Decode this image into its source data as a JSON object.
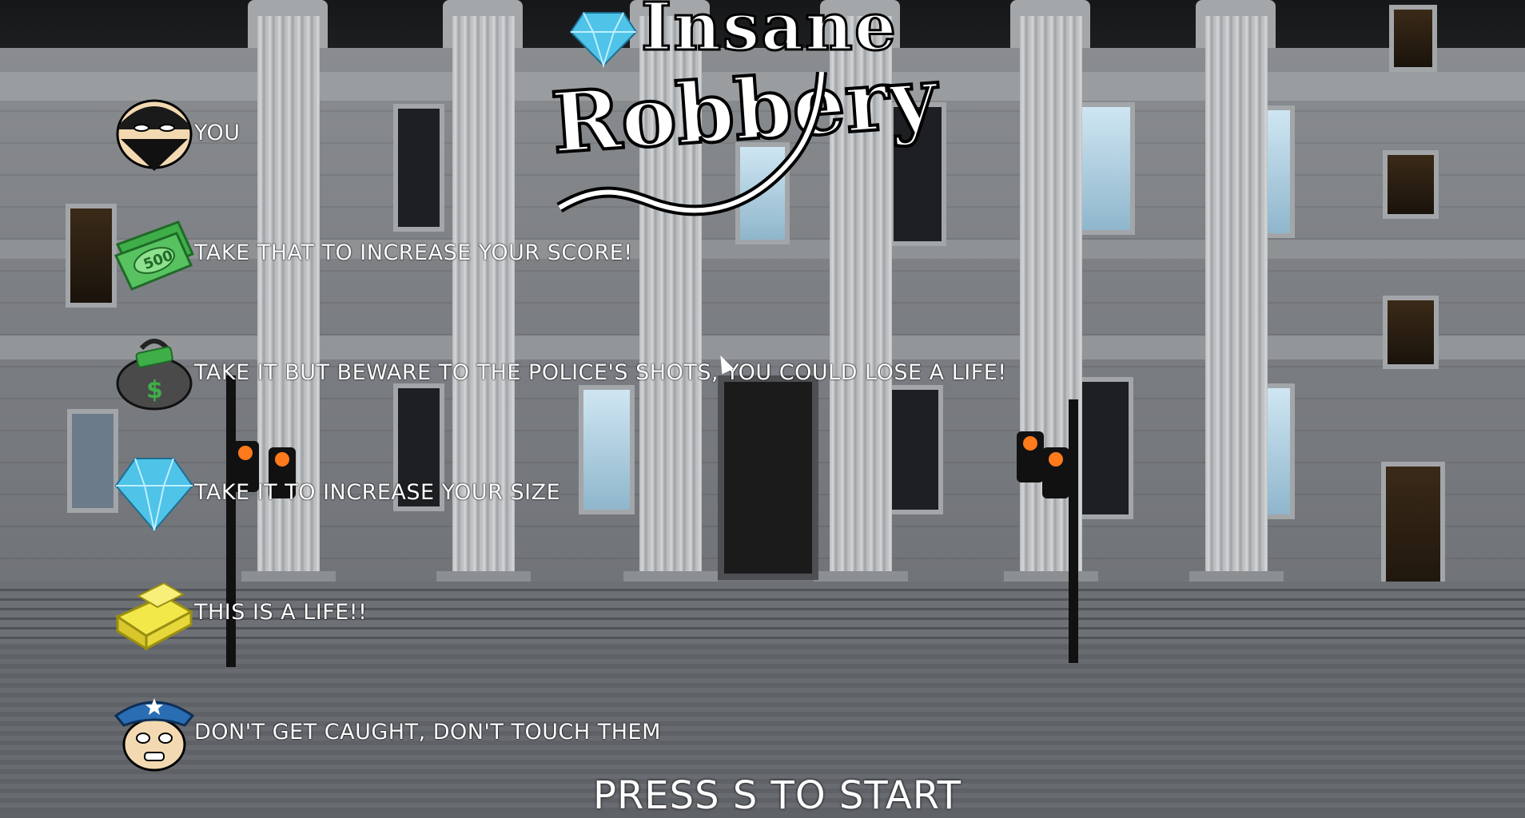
{
  "title": {
    "line1": "Insane",
    "line2": "Robbery"
  },
  "legend": [
    {
      "icon": "robber-icon",
      "text": "YOU"
    },
    {
      "icon": "money-500-icon",
      "text": "TAKE THAT TO INCREASE YOUR SCORE!"
    },
    {
      "icon": "money-bag-icon",
      "text": "TAKE IT BUT BEWARE TO THE POLICE'S SHOTS, YOU COULD LOSE A LIFE!"
    },
    {
      "icon": "diamond-icon",
      "text": "TAKE IT TO INCREASE YOUR SIZE"
    },
    {
      "icon": "gold-bar-icon",
      "text": "THIS IS A LIFE!!"
    },
    {
      "icon": "police-officer-icon",
      "text": "DON'T GET CAUGHT, DON'T TOUCH THEM"
    }
  ],
  "money_note_value": "500",
  "start_prompt": "PRESS S TO START",
  "colors": {
    "text": "#ffffff",
    "money": "#3fae49",
    "diamond": "#4fc3e8",
    "gold": "#f2e84a",
    "police": "#2a6db3",
    "bag": "#4a4a4a"
  }
}
